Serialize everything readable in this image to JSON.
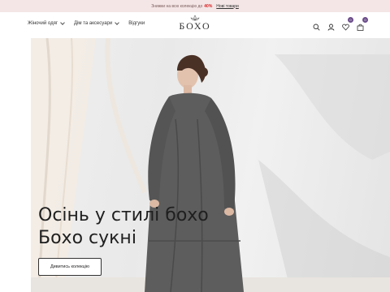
{
  "promo": {
    "prefix": "Знижки на всю колекцію до",
    "discount": "40%",
    "link": "Нові товари"
  },
  "nav": [
    {
      "label": "Жіночий одяг",
      "has_dropdown": true
    },
    {
      "label": "Дім та аксесуари",
      "has_dropdown": true
    },
    {
      "label": "Відгуки",
      "has_dropdown": false
    }
  ],
  "logo": {
    "word": "БОХО"
  },
  "header_icons": [
    {
      "name": "search-icon"
    },
    {
      "name": "user-icon"
    },
    {
      "name": "heart-icon",
      "badge": "0"
    },
    {
      "name": "bag-icon",
      "badge": "0"
    }
  ],
  "hero": {
    "line1": "Осінь у стилі бохо",
    "line2": "Бохо сукні",
    "cta": "Дивитись колекцію"
  },
  "colors": {
    "accent": "#6b4d8a",
    "promo_bg": "#f4e6e6",
    "discount": "#dd2222"
  }
}
